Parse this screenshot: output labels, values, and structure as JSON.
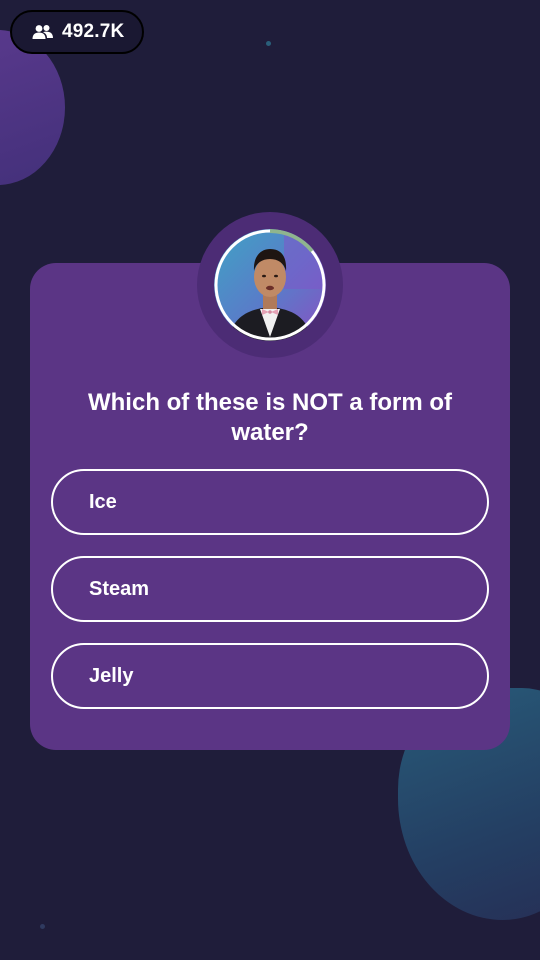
{
  "header": {
    "viewer_count": "492.7K",
    "viewer_icon": "users-icon"
  },
  "host": {
    "avatar_icon": "host-avatar",
    "timer_progress": 0.12
  },
  "question": {
    "text": "Which of these is NOT a form of water?"
  },
  "options": [
    {
      "label": "Ice"
    },
    {
      "label": "Steam"
    },
    {
      "label": "Jelly"
    }
  ],
  "colors": {
    "background": "#1f1d3a",
    "card": "#5b3585",
    "ring": "#4c2c75",
    "option_border": "#ffffff",
    "timer": "#8fb58e"
  }
}
